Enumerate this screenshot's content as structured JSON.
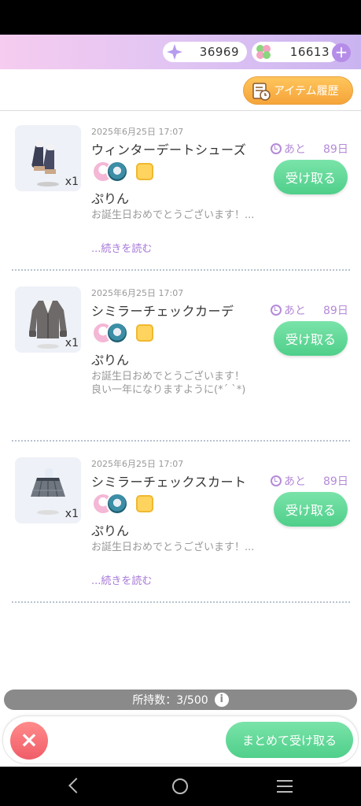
{
  "currency": {
    "gems": "36969",
    "clovers": "16613",
    "gem_icon": "sparkle-gem-icon",
    "clover_icon": "clover-icon"
  },
  "history_button": "アイテム履歴",
  "items": [
    {
      "date": "2025年6月25日 17:07",
      "name": "ウィンターデートシューズ",
      "qty": "x1",
      "timer_prefix": "あと",
      "timer_days": "89日",
      "receive": "受け取る",
      "sender": "ぷりん",
      "message": "お誕生日おめでとうございます！...",
      "more": "...続きを読む"
    },
    {
      "date": "2025年6月25日 17:07",
      "name": "シミラーチェックカーデ",
      "qty": "x1",
      "timer_prefix": "あと",
      "timer_days": "89日",
      "receive": "受け取る",
      "sender": "ぷりん",
      "message": "お誕生日おめでとうございます！\n良い一年になりますように(*´ `*)"
    },
    {
      "date": "2025年6月25日 17:07",
      "name": "シミラーチェックスカート",
      "qty": "x1",
      "timer_prefix": "あと",
      "timer_days": "89日",
      "receive": "受け取る",
      "sender": "ぷりん",
      "message": "お誕生日おめでとうございます！...",
      "more": "...続きを読む"
    }
  ],
  "inventory": "所持数：3/500",
  "bulk_receive": "まとめて受け取る",
  "colors": {
    "accent_green": "#4fcf8a",
    "accent_purple": "#b48ad8",
    "close_red": "#f05d68",
    "history_orange": "#f5a43a"
  }
}
